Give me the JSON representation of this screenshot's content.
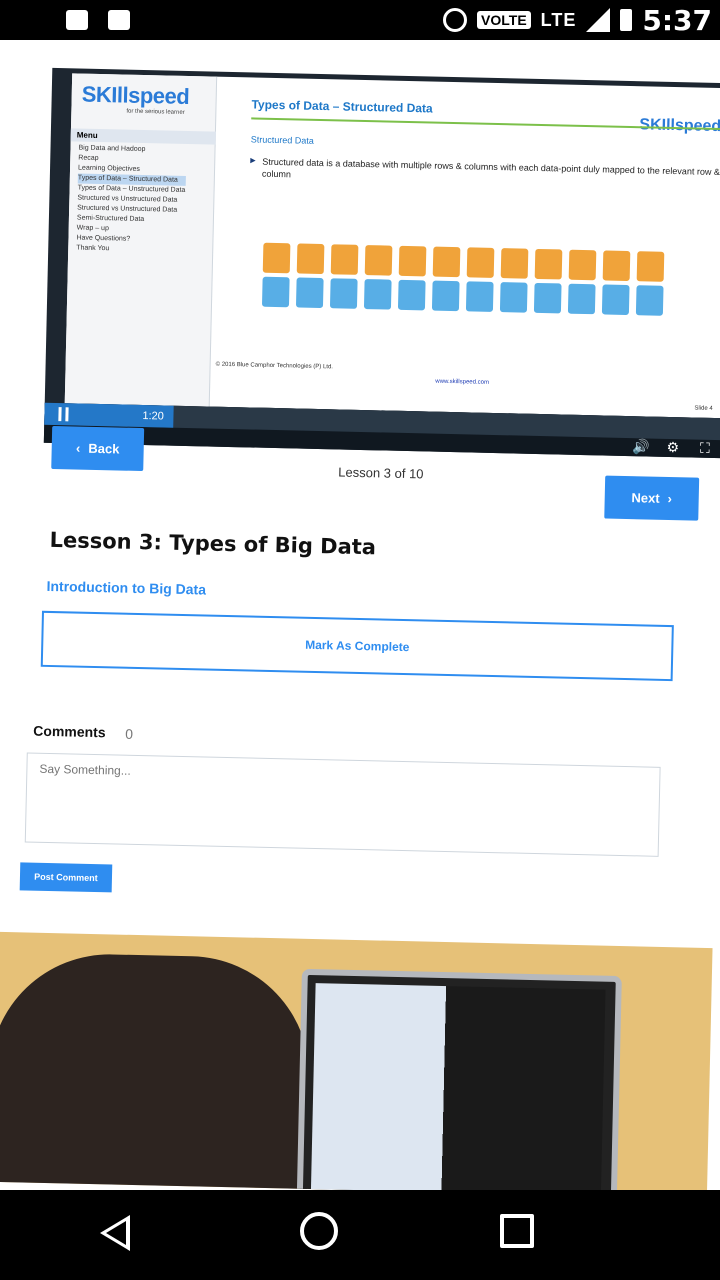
{
  "status_bar": {
    "volte": "VOLTE",
    "network": "LTE",
    "time": "5:37"
  },
  "slide": {
    "logo_a": "SKI",
    "logo_b": "ll",
    "logo_c": "speed",
    "logo_tagline": "for the serious learner",
    "menu_title": "Menu",
    "menu_items": [
      "Big Data and Hadoop",
      "Recap",
      "Learning Objectives",
      "Types of Data – Structured Data",
      "Types of Data – Unstructured Data",
      "Structured vs Unstructured Data",
      "Structured vs Unstructured Data",
      "Semi-Structured Data",
      "Wrap – up",
      "Have Questions?",
      "Thank You"
    ],
    "title": "Types of Data – Structured Data",
    "subtitle": "Structured Data",
    "bullet": "Structured data is a database with multiple rows & columns with each data-point duly mapped to the relevant row & column",
    "copyright": "© 2016 Blue Camphor Technologies (P) Ltd.",
    "url": "www.skillspeed.com",
    "slide_number": "Slide 4"
  },
  "player": {
    "time": "1:20",
    "progress_fraction": 0.19,
    "icons": [
      "volume-icon",
      "settings-icon",
      "fullscreen-icon"
    ]
  },
  "lesson": {
    "back_label": "Back",
    "next_label": "Next",
    "counter": "Lesson 3 of 10",
    "title": "Lesson 3: Types of Big Data",
    "course_link": "Introduction to Big Data",
    "mark_complete": "Mark As Complete"
  },
  "comments": {
    "label": "Comments",
    "count": "0",
    "placeholder": "Say Something...",
    "post_label": "Post Comment"
  },
  "colors": {
    "accent": "#2f8df0",
    "slide_orange": "#f0a33a",
    "slide_blue": "#58aee6"
  }
}
